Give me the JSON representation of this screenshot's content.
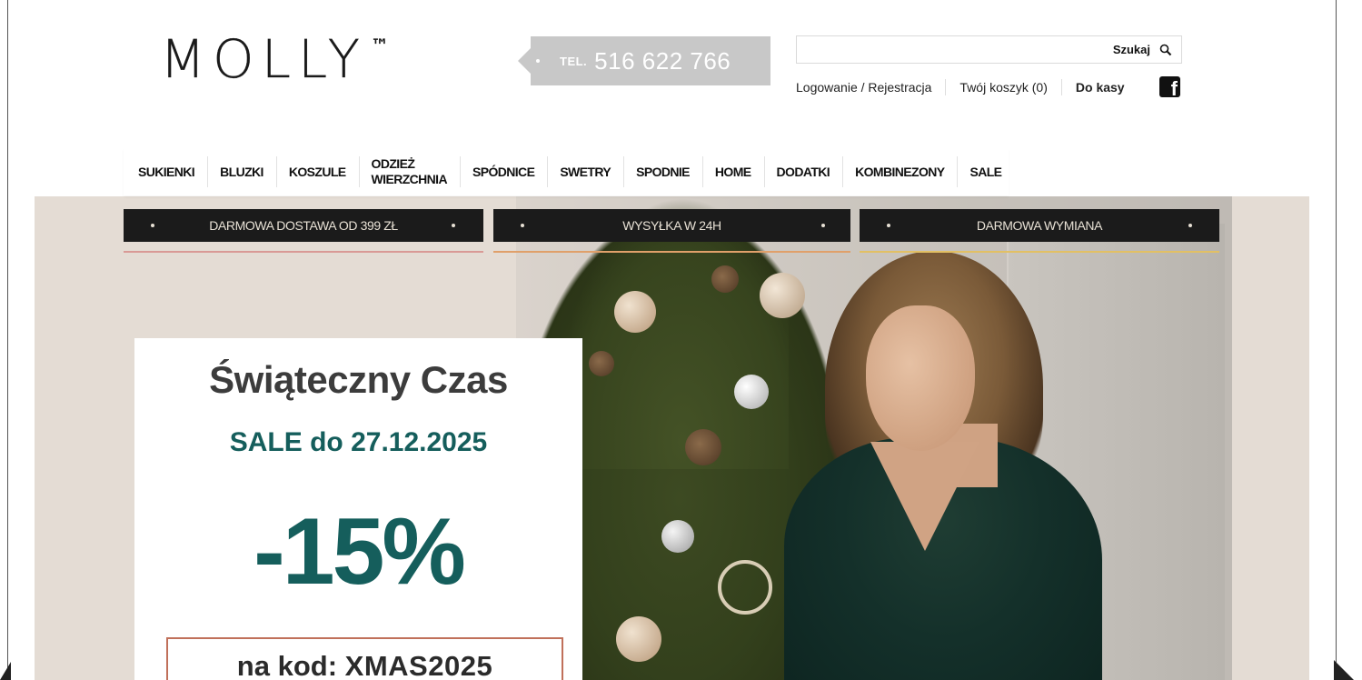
{
  "logo": {
    "text": "MOLLY",
    "tm": "™"
  },
  "phone": {
    "label": "TEL.",
    "number": "516 622 766"
  },
  "search": {
    "label": "Szukaj",
    "placeholder": ""
  },
  "account": {
    "login": "Logowanie / Rejestracja",
    "cart": "Twój koszyk (0)",
    "checkout": "Do kasy"
  },
  "nav": {
    "items": [
      {
        "label": "SUKIENKI"
      },
      {
        "label": "BLUZKI"
      },
      {
        "label": "KOSZULE"
      },
      {
        "label": "ODZIEŻ\nWIERZCHNIA"
      },
      {
        "label": "SPÓDNICE"
      },
      {
        "label": "SWETRY"
      },
      {
        "label": "SPODNIE"
      },
      {
        "label": "HOME"
      },
      {
        "label": "DODATKI"
      },
      {
        "label": "KOMBINEZONY"
      },
      {
        "label": "SALE"
      }
    ]
  },
  "info_bars": [
    {
      "text": "DARMOWA DOSTAWA OD 399 ZŁ",
      "line_color": "#d99a96"
    },
    {
      "text": "WYSYŁKA W 24H",
      "line_color": "#e0a06a"
    },
    {
      "text": "DARMOWA WYMIANA",
      "line_color": "#e2c064"
    }
  ],
  "promo": {
    "title": "Świąteczny Czas",
    "sale": "SALE do 27.12.2025",
    "discount": "-15%",
    "code_prefix": "na kod:",
    "code": "XMAS2025"
  },
  "colors": {
    "promo_teal": "#155e5c",
    "hero_bg": "#e4dcd4",
    "phone_bg": "#c8c8c8",
    "code_border": "#c0705a"
  }
}
